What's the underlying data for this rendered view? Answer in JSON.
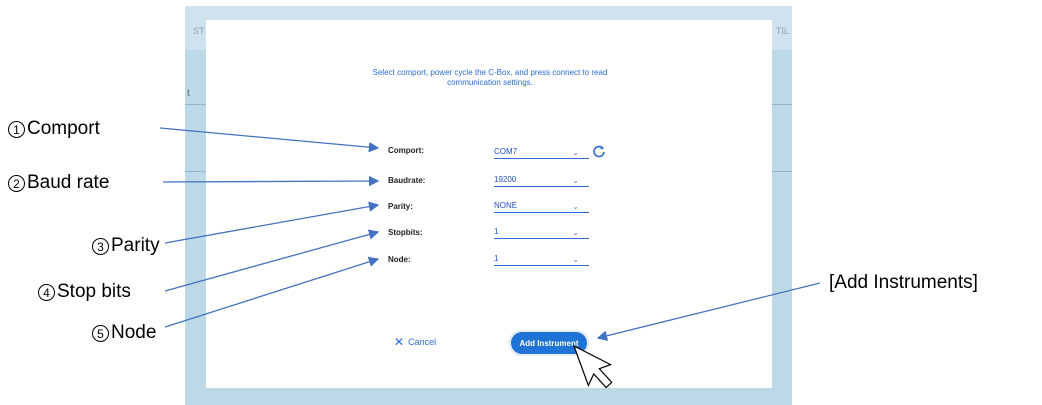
{
  "app": {
    "tab_left": "ST",
    "tab_right": "TIL",
    "side_text": "t"
  },
  "dialog": {
    "instructions": "Select comport, power cycle the C-Box, and press connect to read communication settings.",
    "fields": [
      {
        "label": "Comport:",
        "value": "COM7"
      },
      {
        "label": "Baudrate:",
        "value": "19200"
      },
      {
        "label": "Parity:",
        "value": "NONE"
      },
      {
        "label": "Stopbits:",
        "value": "1"
      },
      {
        "label": "Node:",
        "value": "1"
      }
    ],
    "cancel_label": "Cancel",
    "add_label": "Add Instrument"
  },
  "callouts": [
    {
      "num": "1",
      "text": "Comport"
    },
    {
      "num": "2",
      "text": "Baud rate"
    },
    {
      "num": "3",
      "text": "Parity"
    },
    {
      "num": "4",
      "text": "Stop bits"
    },
    {
      "num": "5",
      "text": "Node"
    }
  ],
  "add_callout": "[Add Instruments]",
  "colors": {
    "accent": "#1f73d6",
    "background": "#bdd9e8"
  }
}
